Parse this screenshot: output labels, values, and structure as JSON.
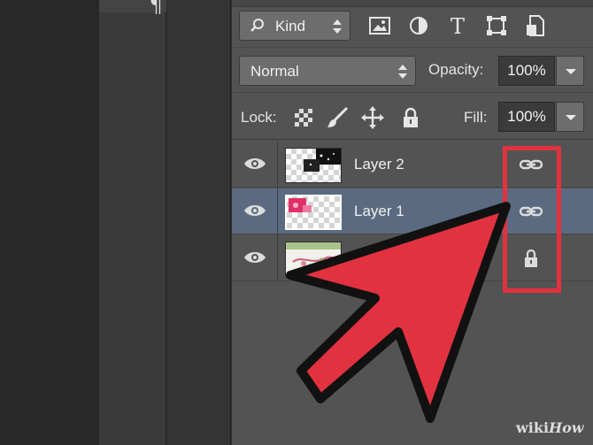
{
  "left_strip": {
    "glyph": "¶"
  },
  "filter_bar": {
    "kind_label": "Kind",
    "filter_icons": [
      "image-filter-icon",
      "adjustment-filter-icon",
      "type-filter-icon",
      "shape-filter-icon",
      "smart-object-filter-icon"
    ],
    "type_glyph": "T"
  },
  "blend_bar": {
    "mode": "Normal",
    "opacity_label": "Opacity:",
    "opacity_value": "100%"
  },
  "lock_bar": {
    "lock_label": "Lock:",
    "fill_label": "Fill:",
    "fill_value": "100%"
  },
  "layers": [
    {
      "name": "Layer 2",
      "visible": true,
      "selected": false,
      "badge": "link-icon"
    },
    {
      "name": "Layer 1",
      "visible": true,
      "selected": true,
      "badge": "link-icon"
    },
    {
      "name": "",
      "visible": true,
      "selected": false,
      "badge": "lock-icon"
    }
  ],
  "annotation": {
    "highlight_color": "#e2323f",
    "arrow_color": "#e2323f"
  },
  "watermark": {
    "wiki": "wiki",
    "how": "How"
  }
}
